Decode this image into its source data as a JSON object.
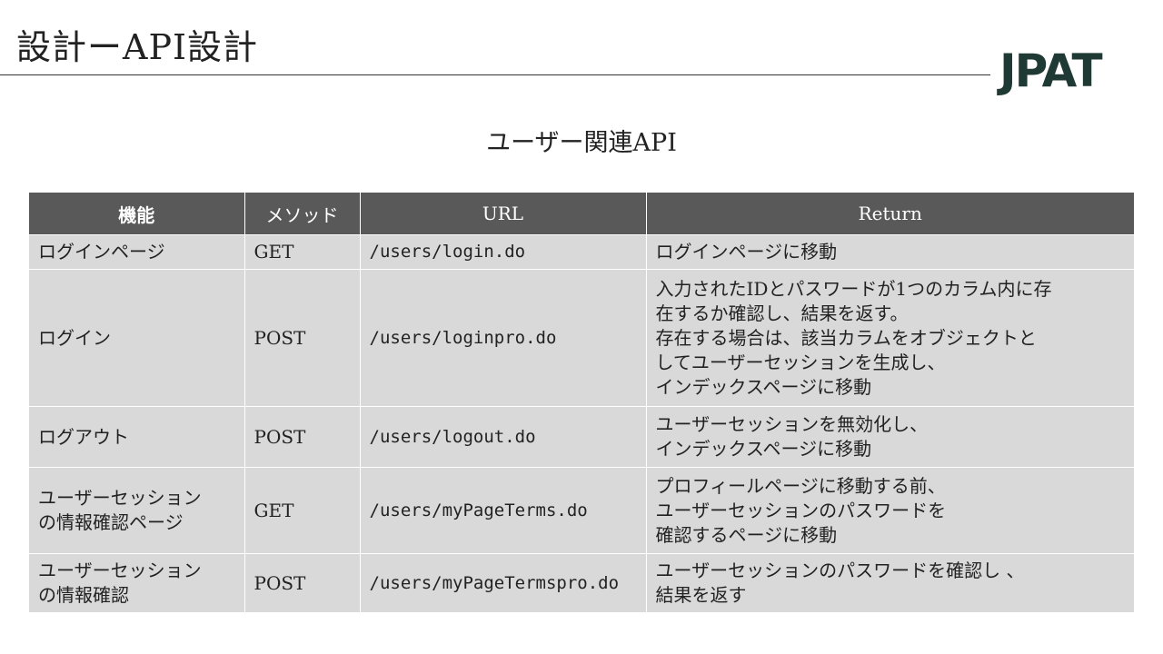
{
  "header": {
    "title": "設計ーAPI設計",
    "logo_text": "JPAT"
  },
  "section": {
    "subtitle": "ユーザー関連API"
  },
  "table": {
    "headers": {
      "feature": "機能",
      "method": "メソッド",
      "url": "URL",
      "return": "Return"
    },
    "rows": [
      {
        "feature": [
          "ログインページ"
        ],
        "method": "GET",
        "url": "/users/login.do",
        "return": [
          "ログインページに移動"
        ]
      },
      {
        "feature": [
          "ログイン"
        ],
        "method": "POST",
        "url": "/users/loginpro.do",
        "return": [
          "入力されたIDとパスワードが1つのカラム内に存",
          "在するか確認し、結果を返す。",
          "存在する場合は、該当カラムをオブジェクトと",
          "してユーザーセッションを生成し、",
          "インデックスページに移動"
        ]
      },
      {
        "feature": [
          "ログアウト"
        ],
        "method": "POST",
        "url": "/users/logout.do",
        "return": [
          "ユーザーセッションを無効化し、",
          "インデックスページに移動"
        ]
      },
      {
        "feature": [
          "ユーザーセッション",
          "の情報確認ページ"
        ],
        "method": "GET",
        "url": "/users/myPageTerms.do",
        "return": [
          "プロフィールページに移動する前、",
          "ユーザーセッションのパスワードを",
          "確認するページに移動"
        ]
      },
      {
        "feature": [
          "ユーザーセッション",
          "の情報確認"
        ],
        "method": "POST",
        "url": "/users/myPageTermspro.do",
        "return": [
          "ユーザーセッションのパスワードを確認し 、",
          "結果を返す"
        ]
      }
    ]
  },
  "colors": {
    "header_bg": "#595959",
    "cell_bg": "#d9d9d9",
    "logo": "#1f3a34"
  }
}
